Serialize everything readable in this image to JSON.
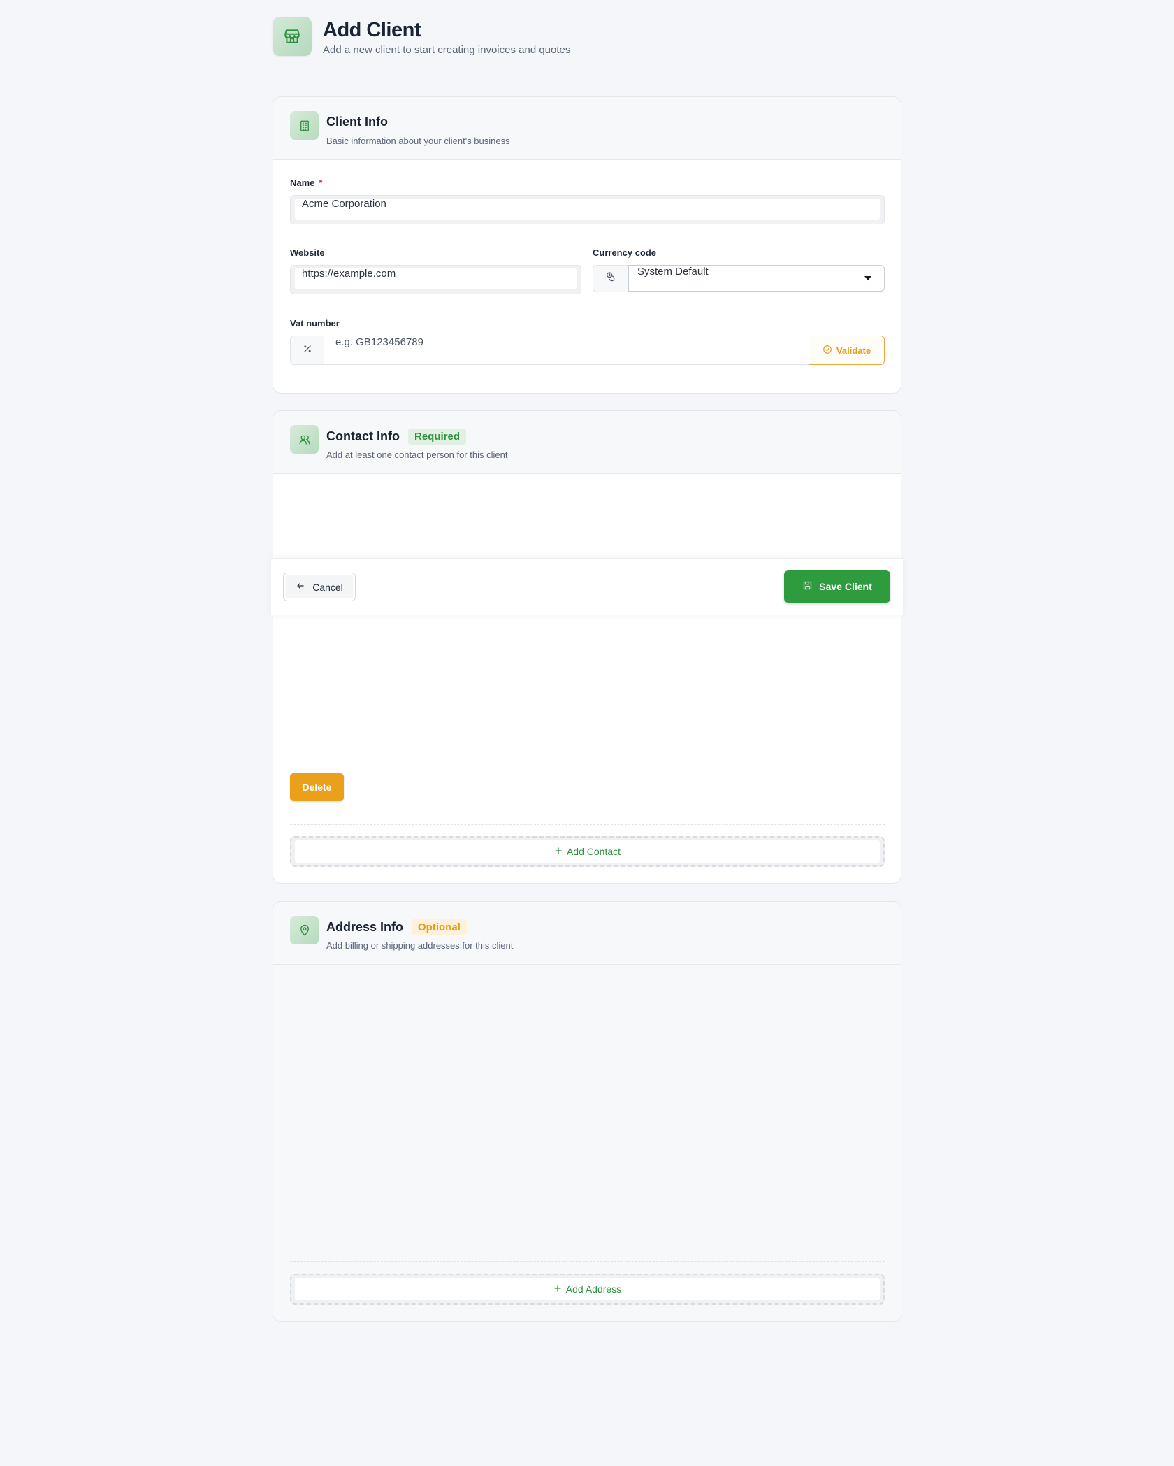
{
  "header": {
    "title": "Add Client",
    "subtitle": "Add a new client to start creating invoices and quotes",
    "icon": "store-icon"
  },
  "client_info": {
    "title": "Client Info",
    "description": "Basic information about your client's business",
    "icon": "building-icon",
    "name_label": "Name",
    "name_required_mark": "*",
    "name_value": "Acme Corporation",
    "website_label": "Website",
    "website_value": "https://example.com",
    "currency_label": "Currency code",
    "currency_value": "System Default",
    "currency_icon": "coins-icon",
    "vat_label": "Vat number",
    "vat_placeholder": "e.g. GB123456789",
    "vat_icon": "percent-icon",
    "validate_label": "Validate"
  },
  "contact_info": {
    "title": "Contact Info",
    "badge": "Required",
    "description": "Add at least one contact person for this client",
    "icon": "users-icon",
    "delete_label": "Delete",
    "add_label": "Add Contact"
  },
  "address_info": {
    "title": "Address Info",
    "badge": "Optional",
    "description": "Add billing or shipping addresses for this client",
    "icon": "map-pin-icon",
    "add_label": "Add Address"
  },
  "actions": {
    "cancel_label": "Cancel",
    "save_label": "Save Client"
  },
  "colors": {
    "primary": "#2e9b3e",
    "warning": "#eba01c",
    "required_star": "#e11d28"
  }
}
